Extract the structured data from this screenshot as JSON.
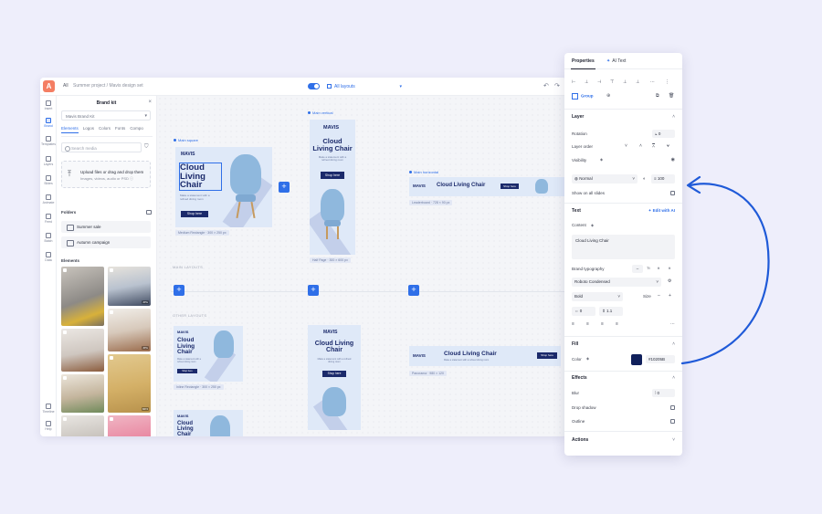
{
  "topbar": {
    "all_label": "All",
    "breadcrumb": "Summer project  /  Mavis design set",
    "layouts_label": "All layouts",
    "undo": "↶",
    "redo": "↷"
  },
  "rail": [
    {
      "label": "Insert",
      "icon": "plus-icon"
    },
    {
      "label": "Brand",
      "icon": "brand-icon"
    },
    {
      "label": "Templates",
      "icon": "templates-icon"
    },
    {
      "label": "Layers",
      "icon": "layers-icon"
    },
    {
      "label": "Slides",
      "icon": "slides-icon"
    },
    {
      "label": "Animate",
      "icon": "animate-icon"
    },
    {
      "label": "Feed",
      "icon": "feed-icon"
    },
    {
      "label": "Batch",
      "icon": "batch-icon"
    },
    {
      "label": "Data",
      "icon": "data-icon"
    },
    {
      "label": "Timeline",
      "icon": "timeline-icon"
    },
    {
      "label": "Help",
      "icon": "help-icon"
    }
  ],
  "brandkit": {
    "title": "Brand kit",
    "close": "×",
    "kit_select": "Mavis Brand Kit",
    "tabs": [
      "Elements",
      "Logos",
      "Colors",
      "Fonts",
      "Compo"
    ],
    "search_placeholder": "Search media",
    "upload_title": "Upload files or drag and drop them",
    "upload_hint": "Images, videos, audio or PSD ⓘ",
    "folders_label": "Folders",
    "folders": [
      "Summer sale",
      "Autumn campaign"
    ],
    "elements_label": "Elements",
    "thumb_tags": [
      "JPG",
      "JPG",
      "PNG",
      "MP4"
    ]
  },
  "canvas": {
    "main_layouts_label": "MAIN LAYOUTS",
    "other_layouts_label": "OTHER LAYOUTS",
    "ad_brand": "MAVIS",
    "ad_headline": "Cloud Living Chair",
    "ad_sub": "Make a statement with a refined dining room",
    "ad_shop": "Shop here",
    "frames": {
      "main_square": "Main square",
      "main_vertical": "Main vertical",
      "main_horizontal": "Main horizontal"
    },
    "sizes": {
      "medium_rectangle": "Medium Rectangle · 300 × 250 px",
      "half_page": "Half Page · 300 × 600 px",
      "leaderboard": "Leaderboard · 728 × 90 px",
      "panorama": "Panorama · 980 × 120",
      "inline_rectangle": "Inline Rectangle · 300 × 250 px"
    }
  },
  "properties": {
    "tabs": {
      "properties": "Properties",
      "ai_text": "AI Text"
    },
    "group_label": "Group",
    "layer": {
      "heading": "Layer",
      "rotation_label": "Rotation",
      "rotation_value": "0",
      "layer_order_label": "Layer order",
      "visibility_label": "Visibility",
      "blend_mode": "Normal",
      "opacity": "100",
      "show_all_label": "Show on all slides"
    },
    "text": {
      "heading": "Text",
      "edit_ai": "Edit with AI",
      "content_label": "Content",
      "content_value": "Cloud Living Chair",
      "typography_label": "Brand typography",
      "typography_options": [
        "Tt",
        "tt",
        "tt"
      ],
      "font_family": "Roboto Condensed",
      "font_weight": "Bold",
      "size_label": "Size",
      "letter_spacing": "0",
      "line_height": "1.1"
    },
    "fill": {
      "heading": "Fill",
      "color_label": "Color",
      "color_hex": "#10205B"
    },
    "effects": {
      "heading": "Effects",
      "blur_label": "Blur",
      "blur_value": "0",
      "drop_shadow_label": "Drop shadow",
      "outline_label": "Outline"
    },
    "actions": {
      "heading": "Actions"
    }
  },
  "colors": {
    "accent": "#2f6fe8",
    "brand_navy": "#10205b",
    "logo": "#f47e63"
  }
}
